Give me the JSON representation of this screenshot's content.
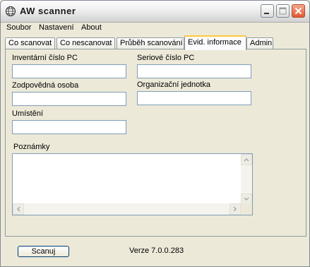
{
  "window": {
    "title": "AW scanner",
    "icon": "globe-logo-icon",
    "controls": [
      "minimize-icon",
      "maximize-icon",
      "close-icon"
    ]
  },
  "menu": {
    "items": [
      "Soubor",
      "Nastavení",
      "About"
    ]
  },
  "tabs": {
    "items": [
      "Co scanovat",
      "Co nescanovat",
      "Průběh scanování",
      "Evid. informace",
      "Admin"
    ],
    "active": "Evid. informace"
  },
  "form": {
    "inventory_label": "Inventární číslo PC",
    "inventory_value": "",
    "serial_label": "Seriové číslo PC",
    "serial_value": "",
    "responsible_label": "Zodpovědná osoba",
    "responsible_value": "",
    "org_label": "Organizační jednotka",
    "org_value": "",
    "location_label": "Umístění",
    "location_value": "",
    "notes_label": "Poznámky",
    "notes_value": ""
  },
  "footer": {
    "scan_button": "Scanuj",
    "version": "Verze 7.0.0.283"
  },
  "colors": {
    "window_bg": "#ece9d8",
    "input_border": "#7f9db9",
    "active_tab_accent": "#ffc83c"
  }
}
